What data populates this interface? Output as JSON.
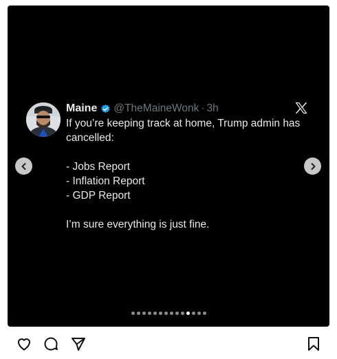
{
  "tweet": {
    "display_name": "Maine",
    "handle": "@TheMaineWonk",
    "separator": "·",
    "time": "3h",
    "lines": [
      "If you’re keeping track at home, Trump admin has cancelled:",
      "",
      "- Jobs Report",
      "- Inflation Report",
      "- GDP Report",
      "",
      "I’m sure everything is just fine."
    ]
  },
  "carousel": {
    "total_slides": 14,
    "active_index": 10
  },
  "icons": {
    "verified": "verified-badge-icon",
    "brand": "x-logo-icon",
    "prev": "chevron-left-icon",
    "next": "chevron-right-icon",
    "like": "heart-icon",
    "comment": "comment-icon",
    "share": "send-icon",
    "save": "bookmark-icon"
  },
  "colors": {
    "background": "#000000",
    "text": "#e7e9ea",
    "muted": "#71767b",
    "verified": "#1d9bf0"
  }
}
